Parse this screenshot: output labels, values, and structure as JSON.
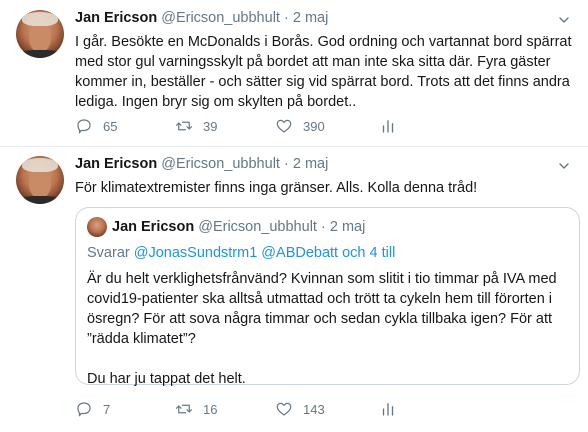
{
  "tweets": [
    {
      "name": "Jan Ericson",
      "handle": "@Ericson_ubbhult",
      "separator": "·",
      "date": "2 maj",
      "text": "I går. Besökte en McDonalds i Borås. God ordning och vartannat bord spärrat med stor gul varningsskylt på bordet att man inte ska sitta där. Fyra gäster kommer in, beställer - och sätter sig vid spärrat bord. Trots att det finns andra lediga. Ingen bryr sig om skylten på bordet..",
      "replies": "65",
      "retweets": "39",
      "likes": "390"
    },
    {
      "name": "Jan Ericson",
      "handle": "@Ericson_ubbhult",
      "separator": "·",
      "date": "2 maj",
      "text": "För klimatextremister finns inga gränser. Alls. Kolla denna tråd!",
      "replies": "7",
      "retweets": "16",
      "likes": "143",
      "quote": {
        "name": "Jan Ericson",
        "handle": "@Ericson_ubbhult",
        "separator": "·",
        "date": "2 maj",
        "reply_prefix": "Svarar",
        "reply_to": "@JonasSundstrm1 @ABDebatt och 4 till",
        "text1": "Är du helt verklighetsfrånvänd? Kvinnan som slitit i tio timmar på IVA med covid19-patienter ska alltså utmattad och trött ta cykeln hem till förorten i ösregn? För att sova några timmar och sedan cykla tillbaka igen? För att ”rädda klimatet”?",
        "text2": "Du har ju tappat det helt."
      }
    }
  ],
  "colors": {
    "text": "#14171a",
    "muted": "#657786",
    "link": "#1b95e0",
    "border": "#e6ecf0"
  },
  "icons": [
    "chevron-down-icon",
    "reply-icon",
    "retweet-icon",
    "like-icon",
    "share-icon"
  ]
}
